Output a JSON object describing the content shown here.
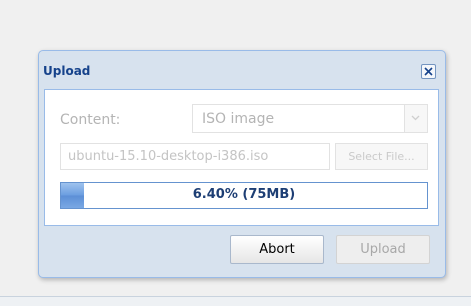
{
  "dialog": {
    "title": "Upload",
    "content_label": "Content:",
    "content_select": {
      "value": "ISO image"
    },
    "file_field": {
      "value": "ubuntu-15.10-desktop-i386.iso"
    },
    "select_file_label": "Select File...",
    "progress": {
      "fraction": 0.064,
      "text": "6.40% (75MB)"
    },
    "abort_label": "Abort",
    "upload_label": "Upload"
  },
  "colors": {
    "title_text": "#15428b",
    "progress_fill": "#6a9de0",
    "dialog_border": "#99bbe8"
  },
  "icons": [
    "close-icon",
    "chevron-down-icon"
  ]
}
